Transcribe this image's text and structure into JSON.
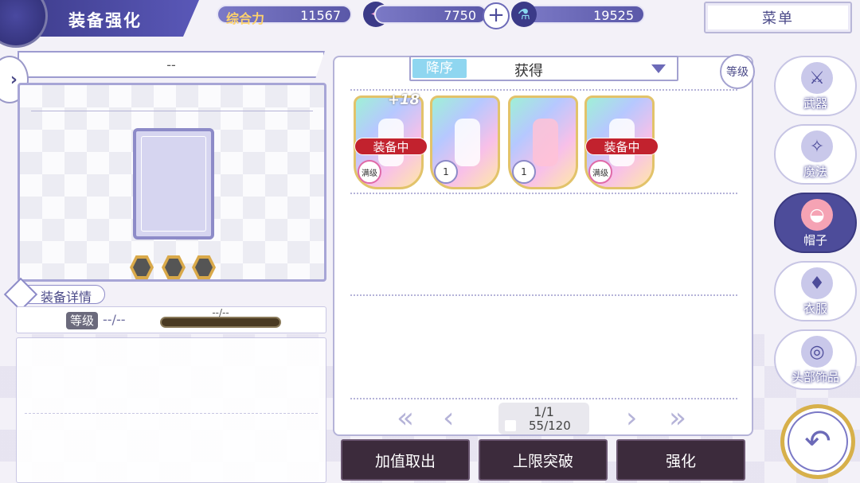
{
  "header": {
    "title": "装备强化",
    "power_label": "综合力",
    "power_value": "11567",
    "currency1_value": "7750",
    "currency2_value": "19525",
    "menu_label": "菜单"
  },
  "left": {
    "item_name": "--",
    "detail_tab": "装备详情",
    "level_label": "等级",
    "level_value": "--/--",
    "exp_text": "--/--"
  },
  "inventory": {
    "sort_order": "降序",
    "sort_value": "获得",
    "level_chip": "等级",
    "items": [
      {
        "badge": "装备中",
        "level": "满级",
        "plus": "+18"
      },
      {
        "badge": "",
        "level": "1",
        "plus": ""
      },
      {
        "badge": "",
        "level": "1",
        "plus": ""
      },
      {
        "badge": "装备中",
        "level": "满级",
        "plus": ""
      }
    ],
    "page": "1/1",
    "count": "55/120"
  },
  "actions": {
    "extract": "加值取出",
    "limit_break": "上限突破",
    "enhance": "强化"
  },
  "categories": [
    {
      "label": "武器",
      "icon": "weapon-icon"
    },
    {
      "label": "魔法",
      "icon": "magic-card-icon"
    },
    {
      "label": "帽子",
      "icon": "hat-icon"
    },
    {
      "label": "衣服",
      "icon": "clothes-icon"
    },
    {
      "label": "头部饰品",
      "icon": "glasses-icon"
    }
  ],
  "colors": {
    "primary": "#4d4c9a",
    "equipped_badge": "#c2222e",
    "action_button": "#3c2b3c"
  }
}
